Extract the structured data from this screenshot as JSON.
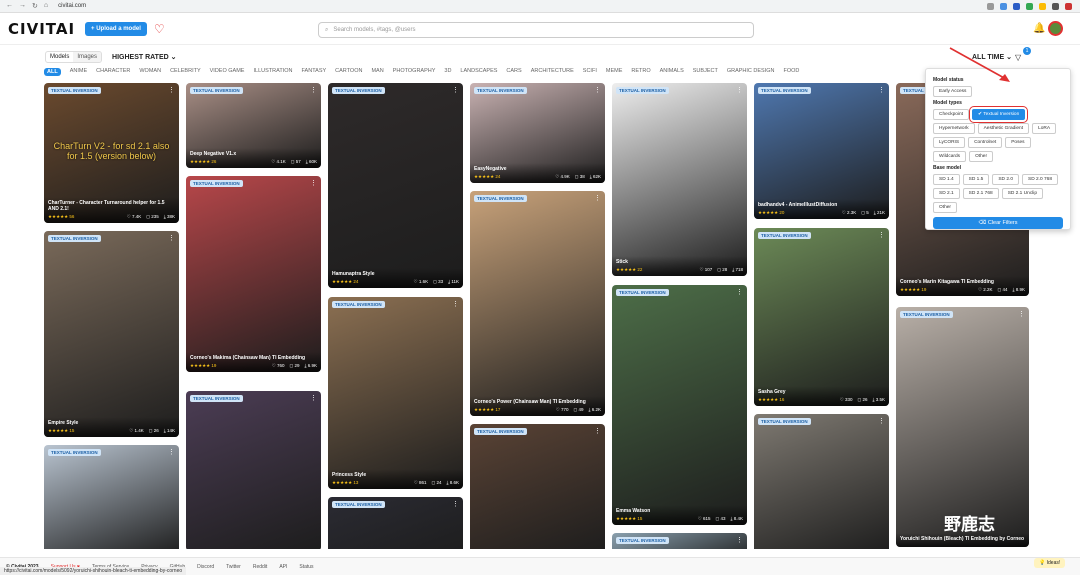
{
  "browser": {
    "url": "civitai.com"
  },
  "header": {
    "logo": "CIVITAI",
    "upload_label": "+ Upload a model",
    "search_placeholder": "Search models, #tags, @users"
  },
  "toolbar": {
    "view_options": [
      "Models",
      "Images"
    ],
    "sort_label": "HIGHEST RATED ⌄",
    "time_label": "ALL TIME ⌄",
    "filter_count": "1"
  },
  "tags": [
    "ALL",
    "ANIME",
    "CHARACTER",
    "WOMAN",
    "CELEBRITY",
    "VIDEO GAME",
    "ILLUSTRATION",
    "FANTASY",
    "CARTOON",
    "MAN",
    "PHOTOGRAPHY",
    "3D",
    "LANDSCAPES",
    "CARS",
    "ARCHITECTURE",
    "SCIFI",
    "MEME",
    "RETRO",
    "ANIMALS",
    "SUBJECT",
    "GRAPHIC DESIGN",
    "FOOD"
  ],
  "cards": [
    {
      "label": "TEXTUAL INVERSION",
      "title": "CharTurner - Character Turnaround helper for 1.5 AND 2.1!",
      "stars": "★★★★★ 56",
      "likes": "♡ 7.4K",
      "comments": "◻ 235",
      "downloads": "⤓ 38K",
      "overlay": "CharTurn V2 - for sd 2.1 also for 1.5 (version below)",
      "color": "#6b4a2e"
    },
    {
      "label": "TEXTUAL INVERSION",
      "title": "Empire Style",
      "stars": "★★★★★ 15",
      "likes": "♡ 1.4K",
      "comments": "◻ 26",
      "downloads": "⤓ 14K",
      "color": "#7a6a5a"
    },
    {
      "label": "TEXTUAL INVERSION",
      "title": "",
      "stars": "",
      "likes": "",
      "comments": "",
      "downloads": "",
      "color": "#b9c4d0"
    },
    {
      "label": "TEXTUAL INVERSION",
      "title": "Deep Negative V1.x",
      "stars": "★★★★★ 26",
      "likes": "♡ 4.1K",
      "comments": "◻ 57",
      "downloads": "⤓ 60K",
      "color": "#a98f86"
    },
    {
      "label": "TEXTUAL INVERSION",
      "title": "Corneo's Makima (Chainsaw Man) TI Embedding",
      "stars": "★★★★★ 19",
      "likes": "♡ 760",
      "comments": "◻ 29",
      "downloads": "⤓ 6.9K",
      "color": "#b8474a"
    },
    {
      "label": "TEXTUAL INVERSION",
      "title": "",
      "stars": "",
      "likes": "",
      "comments": "",
      "downloads": "",
      "color": "#4c3d55"
    },
    {
      "label": "TEXTUAL INVERSION",
      "title": "Hamunaptra Style",
      "stars": "★★★★★ 24",
      "likes": "♡ 1.6K",
      "comments": "◻ 33",
      "downloads": "⤓ 11K",
      "color": "#2e2a2a"
    },
    {
      "label": "TEXTUAL INVERSION",
      "title": "Princess Style",
      "stars": "★★★★★ 13",
      "likes": "♡ 861",
      "comments": "◻ 24",
      "downloads": "⤓ 8.6K",
      "color": "#8c7052"
    },
    {
      "label": "TEXTUAL INVERSION",
      "title": "",
      "stars": "",
      "likes": "",
      "comments": "",
      "downloads": "",
      "color": "#2b2b33"
    },
    {
      "label": "TEXTUAL INVERSION",
      "title": "EasyNegative",
      "stars": "★★★★★ 24",
      "likes": "♡ 4.9K",
      "comments": "◻ 38",
      "downloads": "⤓ 62K",
      "color": "#c9b2b2"
    },
    {
      "label": "TEXTUAL INVERSION",
      "title": "Corneo's Power (Chainsaw Man) TI Embedding",
      "stars": "★★★★★ 17",
      "likes": "♡ 770",
      "comments": "◻ 49",
      "downloads": "⤓ 6.2K",
      "color": "#c8a27a"
    },
    {
      "label": "TEXTUAL INVERSION",
      "title": "",
      "stars": "",
      "likes": "",
      "comments": "",
      "downloads": "",
      "color": "#5a4335"
    },
    {
      "label": "TEXTUAL INVERSION",
      "title": "Stick",
      "stars": "★★★★★ 22",
      "likes": "♡ 107",
      "comments": "◻ 28",
      "downloads": "⤓ 718",
      "color": "#eeeeee"
    },
    {
      "label": "TEXTUAL INVERSION",
      "title": "Emma Watson",
      "stars": "★★★★★ 15",
      "likes": "♡ 615",
      "comments": "◻ 43",
      "downloads": "⤓ 8.4K",
      "color": "#4d6e48"
    },
    {
      "label": "TEXTUAL INVERSION",
      "title": "",
      "stars": "",
      "likes": "",
      "comments": "",
      "downloads": "",
      "color": "#8aa0ae"
    },
    {
      "label": "TEXTUAL INVERSION",
      "title": "badhandv4 - AnimeIllustDiffusion",
      "stars": "★★★★★ 20",
      "likes": "♡ 2.3K",
      "comments": "◻ 5",
      "downloads": "⤓ 21K",
      "color": "#4f78b0"
    },
    {
      "label": "TEXTUAL INVERSION",
      "title": "Sasha Grey",
      "stars": "★★★★★ 16",
      "likes": "♡ 330",
      "comments": "◻ 26",
      "downloads": "⤓ 3.5K",
      "color": "#6c8a57"
    },
    {
      "label": "TEXTUAL INVERSION",
      "title": "",
      "stars": "",
      "likes": "",
      "comments": "",
      "downloads": "",
      "color": "#7f7a72"
    },
    {
      "label": "TEXTUAL INVERSION",
      "title": "Corneo's Marin Kitagawa TI Embedding",
      "stars": "★★★★★ 19",
      "likes": "♡ 2.2K",
      "comments": "◻ 44",
      "downloads": "⤓ 8.9K",
      "color": "#8a6a5a"
    },
    {
      "label": "TEXTUAL INVERSION",
      "title": "Yoruichi Shihouin (Bleach) TI Embedding by Corneo",
      "stars": "",
      "likes": "",
      "comments": "",
      "downloads": "",
      "color": "#b9b0a8"
    }
  ],
  "filter_panel": {
    "status_heading": "Model status",
    "status_options": [
      "Early Access"
    ],
    "types_heading": "Model types",
    "types": [
      "Checkpoint",
      "✔ Textual Inversion",
      "Hypernetwork",
      "Aesthetic Gradient",
      "LoRA",
      "LyCORIS",
      "Controlnet",
      "Poses",
      "Wildcards",
      "Other"
    ],
    "base_heading": "Base model",
    "base": [
      "SD 1.4",
      "SD 1.5",
      "SD 2.0",
      "SD 2.0 768",
      "SD 2.1",
      "SD 2.1 768",
      "SD 2.1 Unclip",
      "Other"
    ],
    "clear_label": "⌫ Clear Filters"
  },
  "footer": {
    "copyright": "© Civitai 2023",
    "links": [
      "Support Us ♥",
      "Terms of Service",
      "Privacy",
      "GitHub",
      "Discord",
      "Twitter",
      "Reddit",
      "API",
      "Status"
    ],
    "ideas": "💡 Ideas!",
    "status_url": "https://civitai.com/models/5092/yoruichi-shihouin-bleach-ti-embedding-by-corneo",
    "watermark": "野鹿志"
  }
}
